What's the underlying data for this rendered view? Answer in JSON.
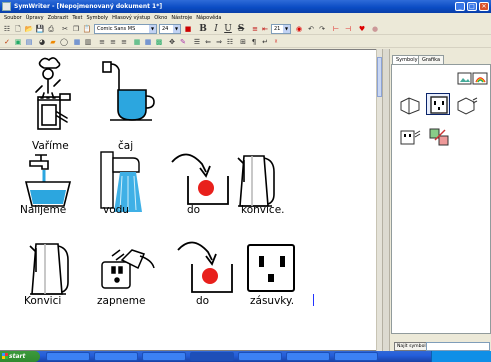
{
  "window": {
    "title": "SymWriter - [Nepojmenovaný dokument 1*]",
    "controls": {
      "minimize": "_",
      "maximize": "□",
      "close": "✕"
    }
  },
  "menu": [
    "Soubor",
    "Úpravy",
    "Zobrazit",
    "Text",
    "Symboly",
    "Hlasový výstup",
    "Okno",
    "Nástroje",
    "Nápověda"
  ],
  "toolbar": {
    "font_name": "Comic Sans MS",
    "font_size": "24",
    "bold": "B",
    "italic": "I",
    "underline": "U",
    "strike": "S",
    "line_spacing": "21"
  },
  "document": {
    "rows": [
      {
        "words": [
          "Vaříme",
          "čaj"
        ]
      },
      {
        "words": [
          "Nalijeme",
          "vodu",
          "do",
          "konvice."
        ]
      },
      {
        "words": [
          "Konvici",
          "zapneme",
          "do",
          "zásuvky."
        ]
      }
    ],
    "symbols": [
      "cook-symbol-icon",
      "tea-symbol-icon",
      "pour-water-symbol-icon",
      "tap-water-symbol-icon",
      "into-symbol-icon",
      "kettle-symbol-icon",
      "kettle-symbol-icon",
      "plug-in-symbol-icon",
      "into-symbol-icon",
      "socket-symbol-icon"
    ]
  },
  "panel": {
    "tabs": [
      "Symboly",
      "Grafika"
    ],
    "active_tab": "Symboly",
    "find_button": "Najít symbol"
  },
  "taskbar": {
    "start_label": "start"
  },
  "colors": {
    "titlebar": "#0a4bc3",
    "caret": "#2233ff",
    "symbol_red": "#e8201c",
    "water_blue": "#3fb0e6"
  }
}
